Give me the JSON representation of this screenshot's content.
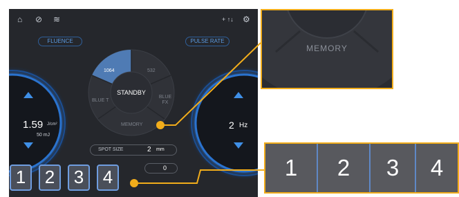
{
  "status_icons": {
    "home": "home-icon",
    "no_sound": "muted-icon",
    "wifi": "wifi-icon",
    "cooling": "cooling-icon",
    "settings": "gear-icon"
  },
  "cooling_label": "+ ↑↓",
  "fluence": {
    "label": "FLUENCE",
    "value": "1.59",
    "unit": "J/cm²",
    "energy": "50 mJ"
  },
  "pulse_rate": {
    "label": "PULSE RATE",
    "value": "2",
    "unit": "Hz"
  },
  "mode_wheel": {
    "center": "STANDBY",
    "segments": {
      "top_left": "1064",
      "top_right": "532",
      "left": "BLUE T",
      "right": "BLUE FX",
      "bottom": "MEMORY"
    },
    "selected": "1064"
  },
  "spot_size": {
    "label": "SPOT SIZE",
    "value": "2",
    "unit": "mm"
  },
  "counter": "0",
  "memory_buttons": [
    "1",
    "2",
    "3",
    "4"
  ],
  "zoom_memory": {
    "label": "MEMORY"
  },
  "zoom_buttons": [
    "1",
    "2",
    "3",
    "4"
  ],
  "colors": {
    "panel_bg": "#25272c",
    "accent_blue": "#3f8fe6",
    "highlight_orange": "#f2ad1b",
    "selected_segment": "#4f7bb4"
  }
}
